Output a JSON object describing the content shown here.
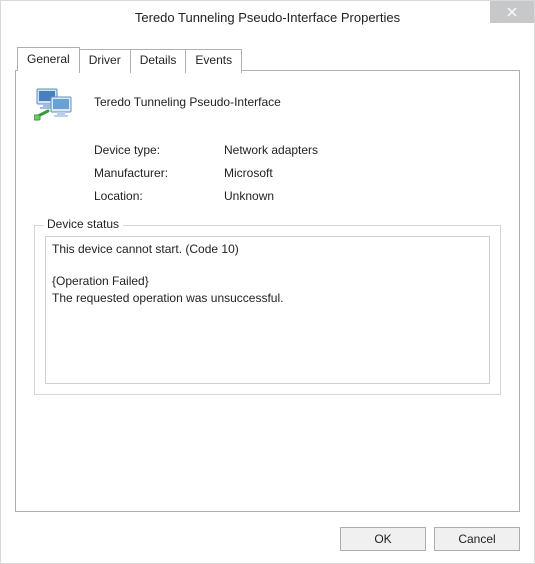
{
  "window": {
    "title": "Teredo Tunneling Pseudo-Interface Properties"
  },
  "tabs": {
    "general": "General",
    "driver": "Driver",
    "details": "Details",
    "events": "Events"
  },
  "device": {
    "name": "Teredo Tunneling Pseudo-Interface",
    "type_label": "Device type:",
    "type_value": "Network adapters",
    "manufacturer_label": "Manufacturer:",
    "manufacturer_value": "Microsoft",
    "location_label": "Location:",
    "location_value": "Unknown"
  },
  "status": {
    "legend": "Device status",
    "text": "This device cannot start. (Code 10)\n\n{Operation Failed}\nThe requested operation was unsuccessful."
  },
  "buttons": {
    "ok": "OK",
    "cancel": "Cancel"
  }
}
